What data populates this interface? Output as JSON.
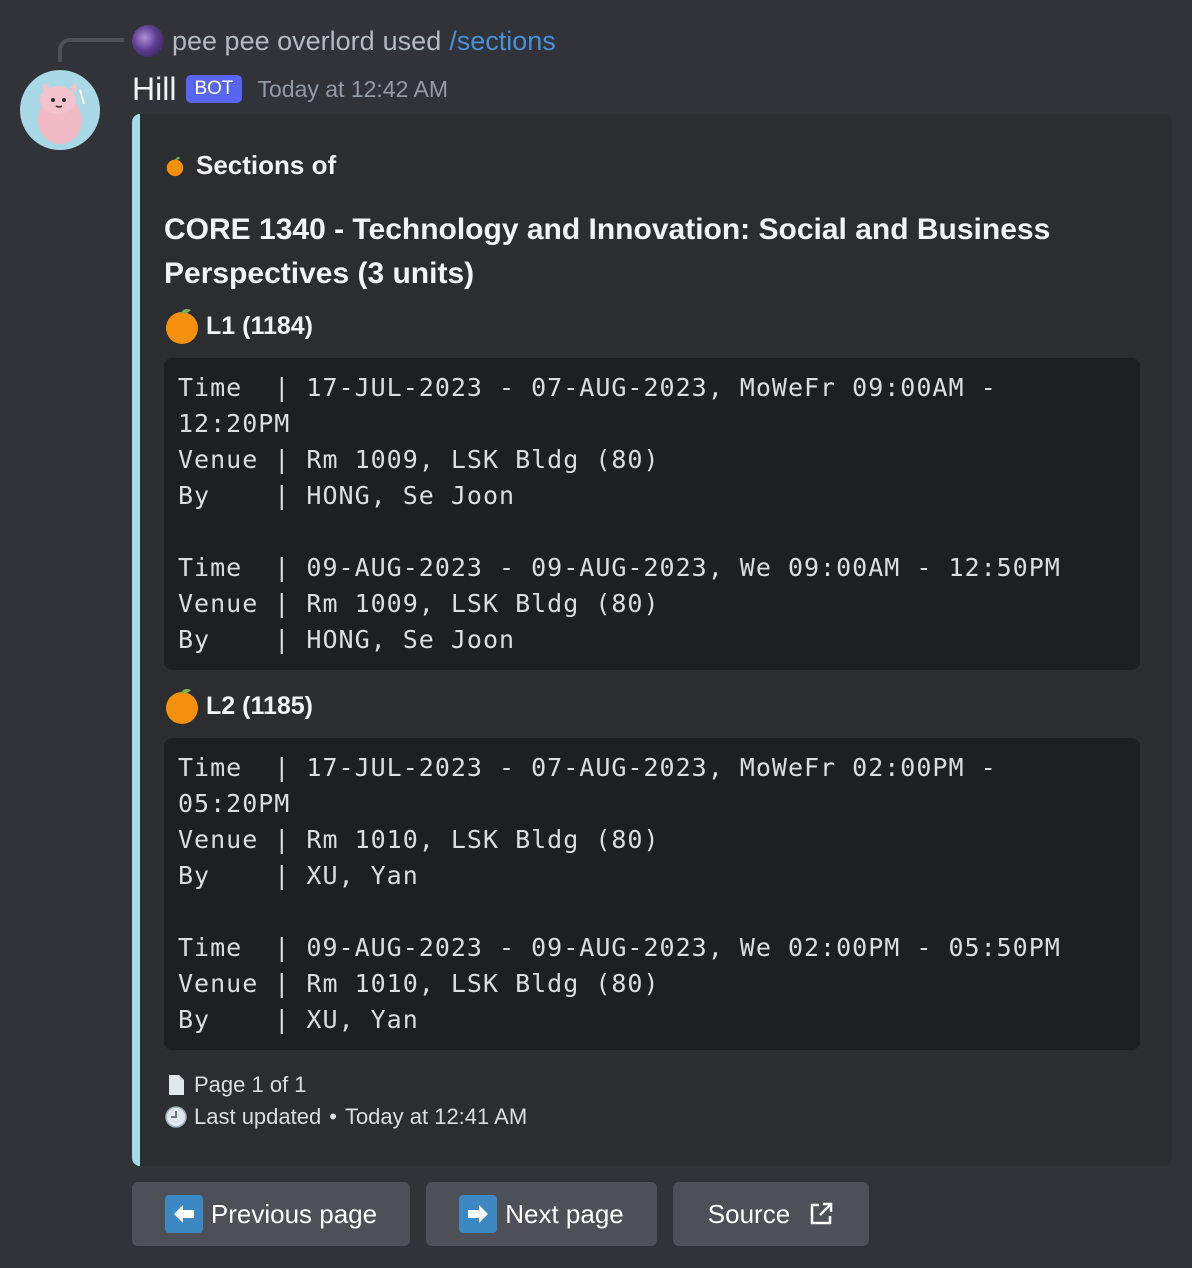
{
  "command": {
    "user": "pee pee overlord",
    "used_text": "used",
    "command_name": "/sections"
  },
  "message": {
    "author": "Hill",
    "bot_tag": "BOT",
    "timestamp": "Today at 12:42 AM"
  },
  "embed": {
    "accent_color": "#a6dbe8",
    "author": "Sections of",
    "title": "CORE 1340 - Technology and Innovation: Social and Business Perspectives (3 units)",
    "fields": [
      {
        "name": "L1 (1184)",
        "lines": [
          "Time  | 17-JUL-2023 - 07-AUG-2023, MoWeFr 09:00AM -",
          "12:20PM",
          "Venue | Rm 1009, LSK Bldg (80)",
          "By    | HONG, Se Joon",
          "",
          "Time  | 09-AUG-2023 - 09-AUG-2023, We 09:00AM - 12:50PM",
          "Venue | Rm 1009, LSK Bldg (80)",
          "By    | HONG, Se Joon"
        ]
      },
      {
        "name": "L2 (1185)",
        "lines": [
          "Time  | 17-JUL-2023 - 07-AUG-2023, MoWeFr 02:00PM -",
          "05:20PM",
          "Venue | Rm 1010, LSK Bldg (80)",
          "By    | XU, Yan",
          "",
          "Time  | 09-AUG-2023 - 09-AUG-2023, We 02:00PM - 05:50PM",
          "Venue | Rm 1010, LSK Bldg (80)",
          "By    | XU, Yan"
        ]
      }
    ],
    "page_info": "Page 1 of 1",
    "last_updated_label": "Last updated",
    "last_updated_sep": "•",
    "last_updated_time": "Today at 12:41 AM"
  },
  "buttons": {
    "previous": "Previous page",
    "next": "Next page",
    "source": "Source"
  },
  "icons": {
    "orange": "tangerine-icon",
    "page": "page-facing-up-icon",
    "clock": "clock-icon",
    "left_arrow": "left-arrow-icon",
    "right_arrow": "right-arrow-icon",
    "external": "external-link-icon"
  }
}
